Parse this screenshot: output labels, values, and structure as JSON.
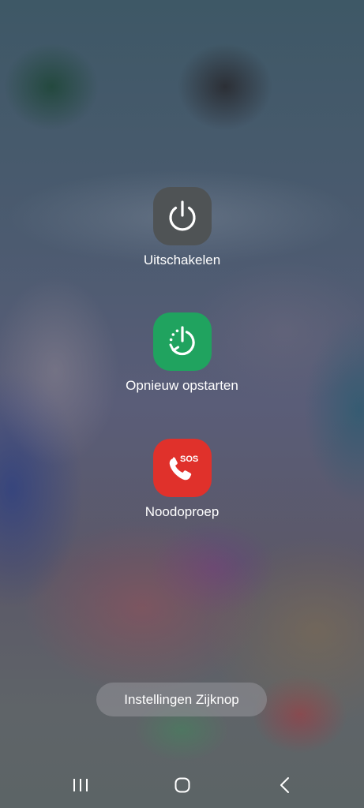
{
  "power_menu": {
    "items": [
      {
        "id": "power-off",
        "label": "Uitschakelen",
        "icon": "power-icon",
        "color": "#4f5355"
      },
      {
        "id": "restart",
        "label": "Opnieuw opstarten",
        "icon": "restart-icon",
        "color": "#20a35f"
      },
      {
        "id": "emergency",
        "label": "Noodoproep",
        "icon": "sos-phone-icon",
        "color": "#e0312b",
        "icon_text": "SOS"
      }
    ]
  },
  "settings_button": {
    "label": "Instellingen Zijknop"
  },
  "navigation_bar": {
    "items": [
      {
        "name": "recent-apps",
        "icon": "recent-apps-icon"
      },
      {
        "name": "home",
        "icon": "home-icon"
      },
      {
        "name": "back",
        "icon": "back-icon"
      }
    ]
  }
}
